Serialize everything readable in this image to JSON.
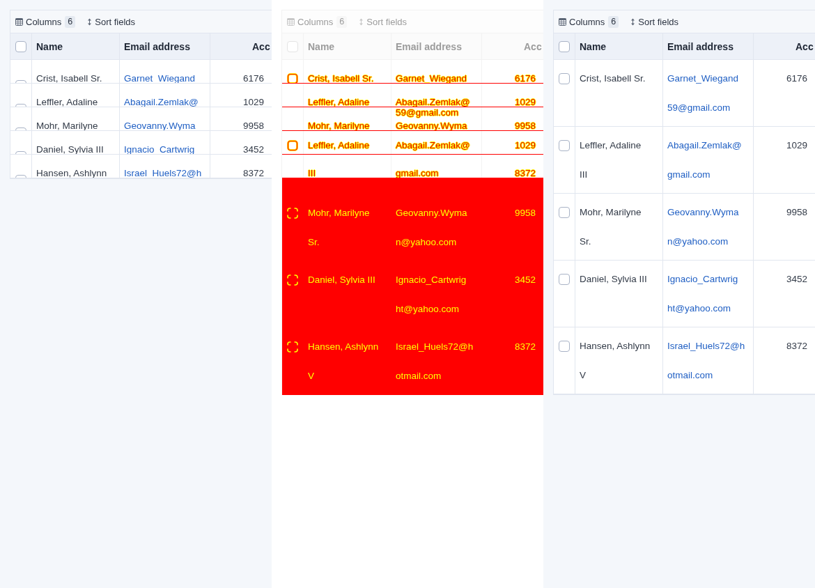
{
  "panels": [
    {
      "kind": "table",
      "rows_clipped": true,
      "toolbar": {
        "columns_label": "Columns",
        "columns_count": "6",
        "sort_label": "Sort fields"
      },
      "header": {
        "checked": false,
        "columns": [
          "Name",
          "Email address",
          "Acc"
        ]
      },
      "rows": [
        {
          "checked": false,
          "name": [
            "Crist, Isabell Sr."
          ],
          "email": [
            "Garnet_Wiegand"
          ],
          "account": "6176"
        },
        {
          "checked": false,
          "name": [
            "Leffler, Adaline"
          ],
          "email": [
            "Abagail.Zemlak@"
          ],
          "account": "1029"
        },
        {
          "checked": false,
          "name": [
            "Mohr, Marilyne"
          ],
          "email": [
            "Geovanny.Wyma"
          ],
          "account": "9958"
        },
        {
          "checked": false,
          "name": [
            "Daniel, Sylvia III"
          ],
          "email": [
            "Ignacio_Cartwrig"
          ],
          "account": "3452"
        },
        {
          "checked": false,
          "name": [
            "Hansen, Ashlynn"
          ],
          "email": [
            "Israel_Huels72@h"
          ],
          "account": "8372"
        }
      ]
    },
    {
      "kind": "diff",
      "toolbar": {
        "columns_label": "Columns",
        "columns_count": "6",
        "sort_label": "Sort fields"
      },
      "header": {
        "checked": false,
        "columns": [
          "Name",
          "Email address",
          "Acc"
        ]
      },
      "changed_bands": [
        {
          "lines": [
            {
              "kind": "cut",
              "checkbox": true,
              "name": "Crist, Isabell Sr.",
              "email": "Garnet_Wiegand",
              "account": "6176"
            }
          ]
        },
        {
          "lines": [
            {
              "kind": "cut",
              "checkbox": false,
              "name": "Leffler, Adaline",
              "email": "Abagail.Zemlak@",
              "account": "1029"
            }
          ]
        },
        {
          "lines": [
            {
              "kind": "whole",
              "checkbox": false,
              "email": "59@gmail.com"
            },
            {
              "kind": "cut",
              "checkbox": false,
              "name": "Mohr, Marilyne",
              "email": "Geovanny.Wyma",
              "account": "9958"
            }
          ]
        },
        {
          "lines": [
            {
              "kind": "whole",
              "checkbox": true,
              "name": "Leffler, Adaline",
              "email": "Abagail.Zemlak@",
              "account": "1029"
            }
          ]
        },
        {
          "lines": [
            {
              "kind": "cut",
              "checkbox": false,
              "name": "III",
              "email": "gmail.com",
              "account": "8372"
            }
          ]
        }
      ],
      "added_rows": [
        {
          "checkbox": true,
          "name": [
            "Mohr, Marilyne",
            "Sr."
          ],
          "email": [
            "Geovanny.Wyma",
            "n@yahoo.com"
          ],
          "account": "9958"
        },
        {
          "checkbox": true,
          "name": [
            "Daniel, Sylvia III"
          ],
          "email": [
            "Ignacio_Cartwrig",
            "ht@yahoo.com"
          ],
          "account": "3452"
        },
        {
          "checkbox": true,
          "name": [
            "Hansen, Ashlynn",
            "V"
          ],
          "email": [
            "Israel_Huels72@h",
            "otmail.com"
          ],
          "account": "8372"
        }
      ]
    },
    {
      "kind": "table",
      "rows_clipped": false,
      "toolbar": {
        "columns_label": "Columns",
        "columns_count": "6",
        "sort_label": "Sort fields"
      },
      "header": {
        "checked": false,
        "columns": [
          "Name",
          "Email address",
          "Acc"
        ]
      },
      "rows": [
        {
          "checked": false,
          "name": [
            "Crist, Isabell Sr."
          ],
          "email": [
            "Garnet_Wiegand",
            "59@gmail.com"
          ],
          "account": "6176"
        },
        {
          "checked": false,
          "name": [
            "Leffler, Adaline",
            "III"
          ],
          "email": [
            "Abagail.Zemlak@",
            "gmail.com"
          ],
          "account": "1029"
        },
        {
          "checked": false,
          "name": [
            "Mohr, Marilyne",
            "Sr."
          ],
          "email": [
            "Geovanny.Wyma",
            "n@yahoo.com"
          ],
          "account": "9958"
        },
        {
          "checked": false,
          "name": [
            "Daniel, Sylvia III"
          ],
          "email": [
            "Ignacio_Cartwrig",
            "ht@yahoo.com"
          ],
          "account": "3452"
        },
        {
          "checked": false,
          "name": [
            "Hansen, Ashlynn",
            "V"
          ],
          "email": [
            "Israel_Huels72@h",
            "otmail.com"
          ],
          "account": "8372"
        }
      ]
    }
  ]
}
